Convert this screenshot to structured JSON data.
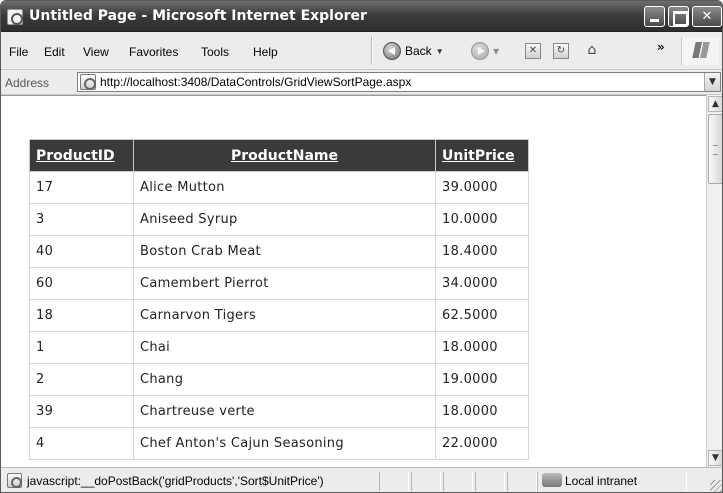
{
  "window": {
    "title": "Untitled Page - Microsoft Internet Explorer"
  },
  "menu": {
    "items": [
      {
        "label": "File"
      },
      {
        "label": "Edit"
      },
      {
        "label": "View"
      },
      {
        "label": "Favorites"
      },
      {
        "label": "Tools"
      },
      {
        "label": "Help"
      }
    ],
    "back_label": "Back",
    "more_label": "»"
  },
  "address": {
    "label": "Address",
    "url": "http://localhost:3408/DataControls/GridViewSortPage.aspx"
  },
  "grid": {
    "columns": [
      "ProductID",
      "ProductName",
      "UnitPrice"
    ],
    "rows": [
      [
        "17",
        "Alice Mutton",
        "39.0000"
      ],
      [
        "3",
        "Aniseed Syrup",
        "10.0000"
      ],
      [
        "40",
        "Boston Crab Meat",
        "18.4000"
      ],
      [
        "60",
        "Camembert Pierrot",
        "34.0000"
      ],
      [
        "18",
        "Carnarvon Tigers",
        "62.5000"
      ],
      [
        "1",
        "Chai",
        "18.0000"
      ],
      [
        "2",
        "Chang",
        "19.0000"
      ],
      [
        "39",
        "Chartreuse verte",
        "18.0000"
      ],
      [
        "4",
        "Chef Anton's Cajun Seasoning",
        "22.0000"
      ]
    ]
  },
  "status": {
    "text": "javascript:__doPostBack('gridProducts','Sort$UnitPrice')",
    "zone": "Local intranet"
  },
  "icons": {
    "app": "ie-page-icon",
    "back": "back-arrow-icon",
    "forward": "forward-arrow-icon",
    "stop": "stop-icon",
    "refresh": "refresh-icon",
    "home": "home-icon",
    "windows": "windows-logo-icon"
  }
}
